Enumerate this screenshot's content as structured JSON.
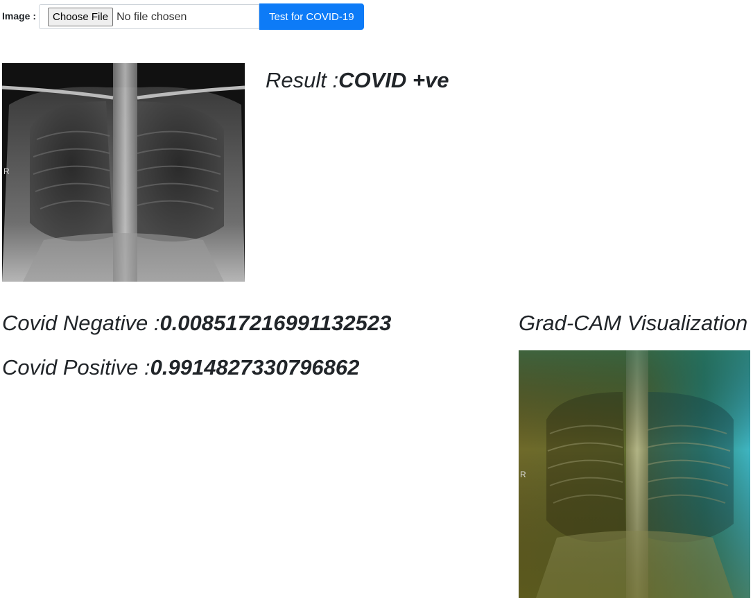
{
  "form": {
    "image_label": "Image :",
    "choose_file_label": "Choose File",
    "no_file_text": "No file chosen",
    "submit_label": "Test for COVID-19"
  },
  "result": {
    "label": "Result :",
    "value": "COVID +ve"
  },
  "scores": {
    "negative_label": "Covid Negative :",
    "negative_value": "0.008517216991132523",
    "positive_label": "Covid Positive :",
    "positive_value": "0.9914827330796862"
  },
  "gradcam": {
    "title": "Grad-CAM Visualization"
  },
  "images": {
    "xray_marker": "R",
    "gradcam_marker": "R"
  },
  "colors": {
    "submit_button": "#0d7bf7",
    "text": "#212529"
  }
}
